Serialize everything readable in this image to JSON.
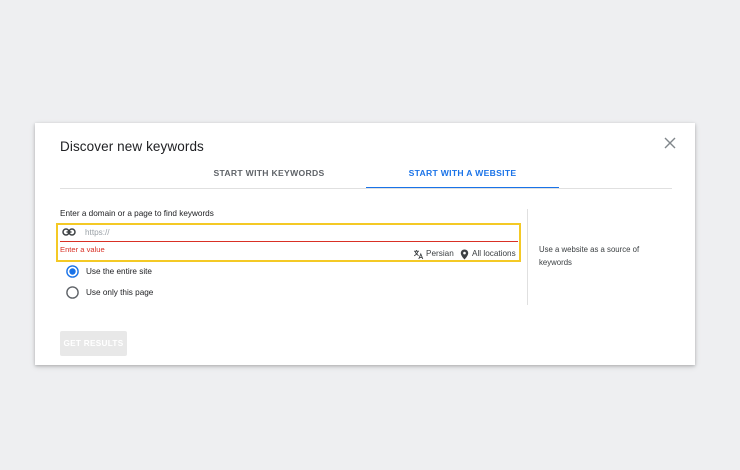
{
  "dialog": {
    "title": "Discover new keywords",
    "close_icon": "close-icon"
  },
  "tabs": [
    {
      "label": "START WITH KEYWORDS",
      "active": false
    },
    {
      "label": "START WITH A WEBSITE",
      "active": true
    }
  ],
  "website_form": {
    "prompt": "Enter a domain or a page to find keywords",
    "url_value": "",
    "url_placeholder": "https://",
    "link_icon": "link-icon",
    "error": "Enter a value",
    "language_icon": "translate-icon",
    "language": "Persian",
    "location_icon": "location-pin-icon",
    "location": "All locations",
    "scope_options": [
      {
        "label": "Use the entire site",
        "selected": true
      },
      {
        "label": "Use only this page",
        "selected": false
      }
    ],
    "side_note": "Use a website as a source of keywords"
  },
  "actions": {
    "get_results_label": "GET RESULTS",
    "get_results_enabled": false
  },
  "colors": {
    "accent": "#1a73e8",
    "error": "#d93025",
    "highlight": "#f4c925",
    "background": "#eeeff1"
  }
}
